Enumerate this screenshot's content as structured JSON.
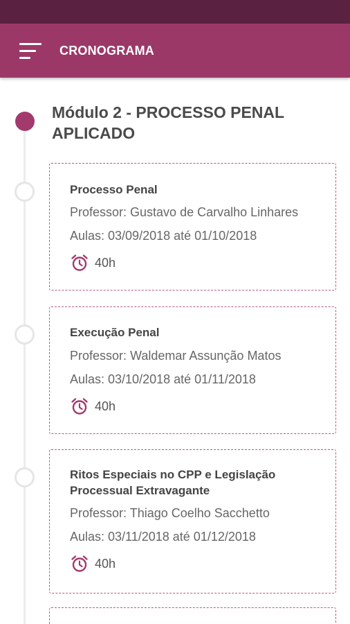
{
  "app_bar": {
    "title": "CRONOGRAMA",
    "color": "#9b3868",
    "status_color": "#5a2140"
  },
  "module": {
    "title": "Módulo 2 - PROCESSO PENAL APLICADO"
  },
  "courses": [
    {
      "title": "Processo Penal",
      "professor": "Professor: Gustavo de Carvalho Linhares",
      "dates": "Aulas: 03/09/2018 até 01/10/2018",
      "hours": "40h"
    },
    {
      "title": "Execução Penal",
      "professor": "Professor: Waldemar Assunção Matos",
      "dates": "Aulas: 03/10/2018 até 01/11/2018",
      "hours": "40h"
    },
    {
      "title": "Ritos Especiais no CPP e Legislação Processual Extravagante",
      "professor": "Professor: Thiago Coelho Sacchetto",
      "dates": "Aulas: 03/11/2018 até 01/12/2018",
      "hours": "40h"
    }
  ],
  "icons": {
    "menu": "menu-icon",
    "clock": "alarm-clock-icon",
    "accent": "#a23a6d"
  }
}
